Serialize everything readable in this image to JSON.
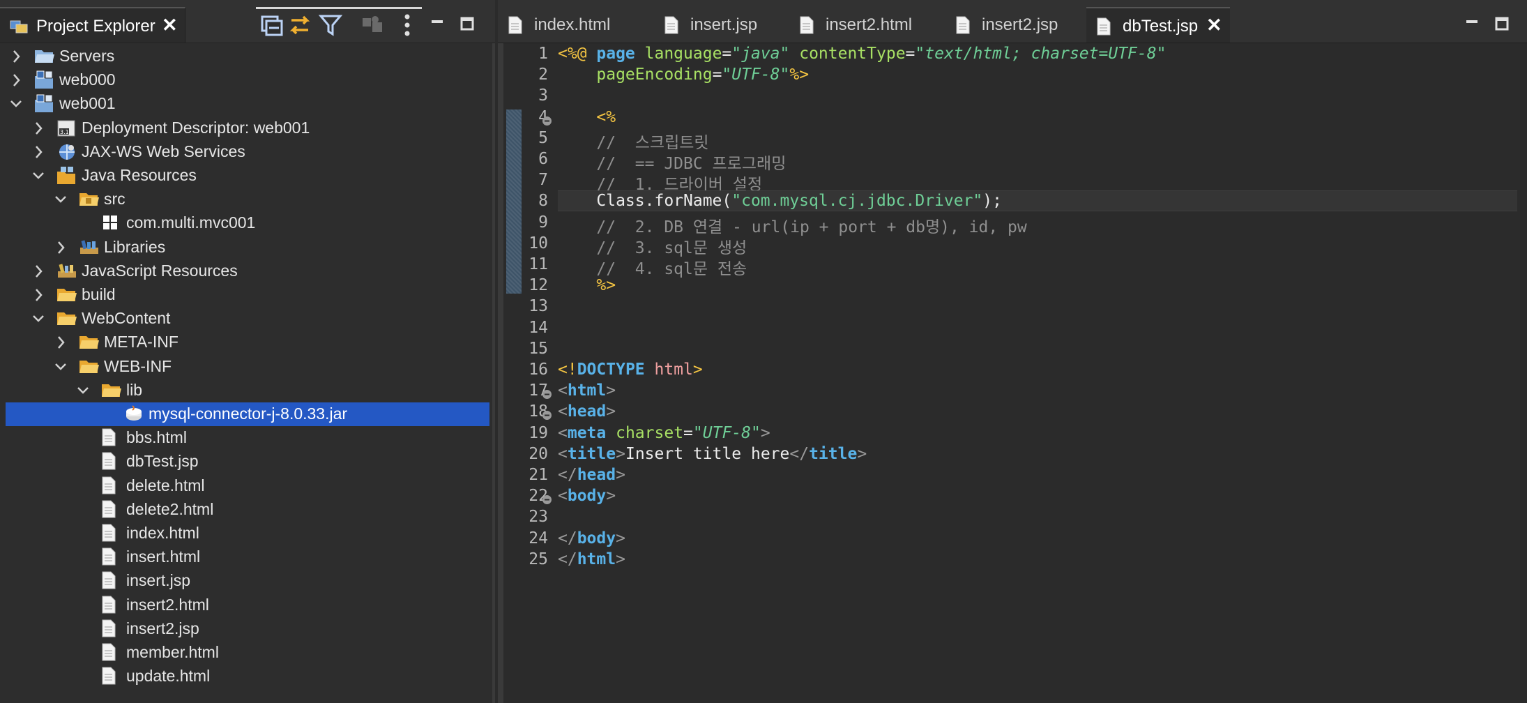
{
  "colors": {
    "selection": "#2458c4",
    "keyword": "#59b2e8",
    "jsp_delimiter": "#f5c542",
    "attribute": "#a8e064",
    "string": "#6fcf97",
    "comment": "#8f8f8f"
  },
  "explorer": {
    "tab_label": "Project Explorer",
    "tab_icon": "project-explorer-icon",
    "toolbar_icons": [
      "collapse-all-icon",
      "link-with-editor-icon",
      "filter-icon",
      "focus-icon",
      "view-menu-icon"
    ],
    "tree": [
      {
        "label": "Servers",
        "expanded": false,
        "icon": "folder-server-icon"
      },
      {
        "label": "web000",
        "expanded": false,
        "icon": "web-project-icon"
      },
      {
        "label": "web001",
        "expanded": true,
        "icon": "web-project-icon"
      },
      {
        "label": "Deployment Descriptor: web001",
        "expanded": false,
        "icon": "deployment-descriptor-icon"
      },
      {
        "label": "JAX-WS Web Services",
        "expanded": false,
        "icon": "web-services-icon"
      },
      {
        "label": "Java Resources",
        "expanded": true,
        "icon": "java-resources-icon"
      },
      {
        "label": "src",
        "expanded": true,
        "icon": "source-folder-icon"
      },
      {
        "label": "com.multi.mvc001",
        "expanded": null,
        "icon": "package-icon"
      },
      {
        "label": "Libraries",
        "expanded": false,
        "icon": "libraries-icon"
      },
      {
        "label": "JavaScript Resources",
        "expanded": false,
        "icon": "javascript-resources-icon"
      },
      {
        "label": "build",
        "expanded": false,
        "icon": "folder-icon"
      },
      {
        "label": "WebContent",
        "expanded": true,
        "icon": "folder-icon"
      },
      {
        "label": "META-INF",
        "expanded": false,
        "icon": "folder-icon"
      },
      {
        "label": "WEB-INF",
        "expanded": true,
        "icon": "folder-icon"
      },
      {
        "label": "lib",
        "expanded": true,
        "icon": "folder-icon"
      },
      {
        "label": "mysql-connector-j-8.0.33.jar",
        "expanded": null,
        "icon": "jar-icon",
        "selected": true
      },
      {
        "label": "bbs.html",
        "expanded": null,
        "icon": "file-icon"
      },
      {
        "label": "dbTest.jsp",
        "expanded": null,
        "icon": "file-icon"
      },
      {
        "label": "delete.html",
        "expanded": null,
        "icon": "file-icon"
      },
      {
        "label": "delete2.html",
        "expanded": null,
        "icon": "file-icon"
      },
      {
        "label": "index.html",
        "expanded": null,
        "icon": "file-icon"
      },
      {
        "label": "insert.html",
        "expanded": null,
        "icon": "file-icon"
      },
      {
        "label": "insert.jsp",
        "expanded": null,
        "icon": "file-icon"
      },
      {
        "label": "insert2.html",
        "expanded": null,
        "icon": "file-icon"
      },
      {
        "label": "insert2.jsp",
        "expanded": null,
        "icon": "file-icon"
      },
      {
        "label": "member.html",
        "expanded": null,
        "icon": "file-icon"
      },
      {
        "label": "update.html",
        "expanded": null,
        "icon": "file-icon"
      }
    ]
  },
  "editor": {
    "tabs": [
      {
        "label": "index.html",
        "active": false
      },
      {
        "label": "insert.jsp",
        "active": false
      },
      {
        "label": "insert2.html",
        "active": false
      },
      {
        "label": "insert2.jsp",
        "active": false
      },
      {
        "label": "dbTest.jsp",
        "active": true
      }
    ],
    "current_line": 8,
    "lines": [
      {
        "n": "1",
        "fold": false,
        "tokens": [
          [
            "jsp",
            "<%@ "
          ],
          [
            "kw",
            "page "
          ],
          [
            "attr",
            "language"
          ],
          [
            "plain",
            "="
          ],
          [
            "str",
            "\"java\" "
          ],
          [
            "attr",
            "contentType"
          ],
          [
            "plain",
            "="
          ],
          [
            "str",
            "\"text/html; charset=UTF-8\""
          ]
        ]
      },
      {
        "n": "2",
        "fold": false,
        "tokens": [
          [
            "plain",
            "    "
          ],
          [
            "attr",
            "pageEncoding"
          ],
          [
            "plain",
            "="
          ],
          [
            "str",
            "\"UTF-8\""
          ],
          [
            "jsp",
            "%>"
          ]
        ]
      },
      {
        "n": "3",
        "fold": false,
        "tokens": []
      },
      {
        "n": "4",
        "fold": true,
        "tokens": [
          [
            "plain",
            "    "
          ],
          [
            "jsp",
            "<%"
          ]
        ]
      },
      {
        "n": "5",
        "fold": false,
        "tokens": [
          [
            "cm",
            "    //  스크립트릿"
          ]
        ]
      },
      {
        "n": "6",
        "fold": false,
        "tokens": [
          [
            "cm",
            "    //  == JDBC 프로그래밍"
          ]
        ]
      },
      {
        "n": "7",
        "fold": false,
        "tokens": [
          [
            "cm",
            "    //  1. 드라이버 설정"
          ]
        ]
      },
      {
        "n": "8",
        "fold": false,
        "tokens": [
          [
            "plain",
            "    Class.forName("
          ],
          [
            "jstr",
            "\"com.mysql.cj.jdbc.Driver\""
          ],
          [
            "plain",
            ");"
          ]
        ]
      },
      {
        "n": "9",
        "fold": false,
        "tokens": [
          [
            "cm",
            "    //  2. DB 연결 - url(ip + port + db명), id, pw"
          ]
        ]
      },
      {
        "n": "10",
        "fold": false,
        "tokens": [
          [
            "cm",
            "    //  3. sql문 생성"
          ]
        ]
      },
      {
        "n": "11",
        "fold": false,
        "tokens": [
          [
            "cm",
            "    //  4. sql문 전송"
          ]
        ]
      },
      {
        "n": "12",
        "fold": false,
        "tokens": [
          [
            "plain",
            "    "
          ],
          [
            "jsp",
            "%>"
          ]
        ]
      },
      {
        "n": "13",
        "fold": false,
        "tokens": []
      },
      {
        "n": "14",
        "fold": false,
        "tokens": []
      },
      {
        "n": "15",
        "fold": false,
        "tokens": []
      },
      {
        "n": "16",
        "fold": false,
        "tokens": [
          [
            "jsp",
            "<!"
          ],
          [
            "tag",
            "DOCTYPE "
          ],
          [
            "doc",
            "html"
          ],
          [
            "jsp",
            ">"
          ]
        ]
      },
      {
        "n": "17",
        "fold": true,
        "tokens": [
          [
            "br",
            "<"
          ],
          [
            "tag",
            "html"
          ],
          [
            "br",
            ">"
          ]
        ]
      },
      {
        "n": "18",
        "fold": true,
        "tokens": [
          [
            "br",
            "<"
          ],
          [
            "tag",
            "head"
          ],
          [
            "br",
            ">"
          ]
        ]
      },
      {
        "n": "19",
        "fold": false,
        "tokens": [
          [
            "br",
            "<"
          ],
          [
            "tag",
            "meta "
          ],
          [
            "attr",
            "charset"
          ],
          [
            "plain",
            "="
          ],
          [
            "str",
            "\"UTF-8\""
          ],
          [
            "br",
            ">"
          ]
        ]
      },
      {
        "n": "20",
        "fold": false,
        "tokens": [
          [
            "br",
            "<"
          ],
          [
            "tag",
            "title"
          ],
          [
            "br",
            ">"
          ],
          [
            "plain",
            "Insert title here"
          ],
          [
            "br",
            "</"
          ],
          [
            "tag",
            "title"
          ],
          [
            "br",
            ">"
          ]
        ]
      },
      {
        "n": "21",
        "fold": false,
        "tokens": [
          [
            "br",
            "</"
          ],
          [
            "tag",
            "head"
          ],
          [
            "br",
            ">"
          ]
        ]
      },
      {
        "n": "22",
        "fold": true,
        "tokens": [
          [
            "br",
            "<"
          ],
          [
            "tag",
            "body"
          ],
          [
            "br",
            ">"
          ]
        ]
      },
      {
        "n": "23",
        "fold": false,
        "tokens": []
      },
      {
        "n": "24",
        "fold": false,
        "tokens": [
          [
            "br",
            "</"
          ],
          [
            "tag",
            "body"
          ],
          [
            "br",
            ">"
          ]
        ]
      },
      {
        "n": "25",
        "fold": false,
        "tokens": [
          [
            "br",
            "</"
          ],
          [
            "tag",
            "html"
          ],
          [
            "br",
            ">"
          ]
        ]
      }
    ]
  }
}
